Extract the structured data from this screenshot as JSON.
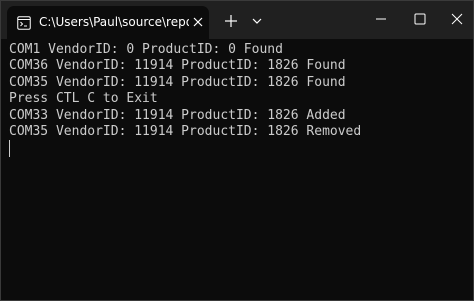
{
  "tab": {
    "title": "C:\\Users\\Paul\\source\\repos\\S",
    "icon": "terminal-icon"
  },
  "titlebar_buttons": {
    "new_tab_icon": "plus-icon",
    "dropdown_icon": "chevron-down-icon",
    "minimize_icon": "minimize-icon",
    "maximize_icon": "maximize-icon",
    "close_icon": "close-icon"
  },
  "console": {
    "lines": [
      "COM1 VendorID: 0 ProductID: 0 Found",
      "COM36 VendorID: 11914 ProductID: 1826 Found",
      "COM35 VendorID: 11914 ProductID: 1826 Found",
      "Press CTL C to Exit",
      "COM33 VendorID: 11914 ProductID: 1826 Added",
      "COM35 VendorID: 11914 ProductID: 1826 Removed"
    ]
  },
  "colors": {
    "background": "#0c0c0c",
    "titlebar": "#202020",
    "text": "#cccccc"
  }
}
